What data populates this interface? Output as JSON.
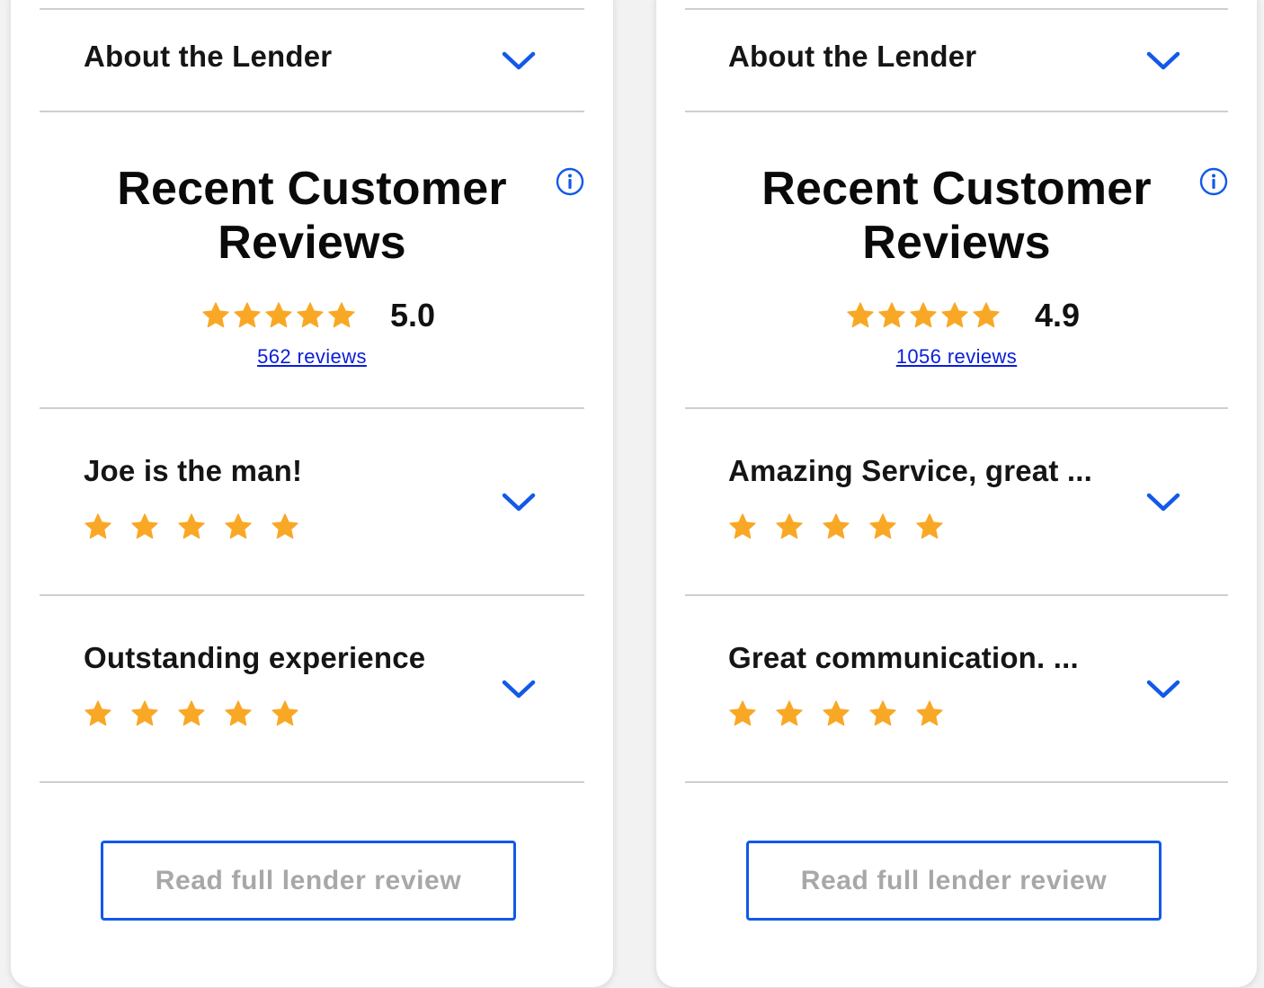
{
  "colors": {
    "accent": "#1259e8",
    "star": "#f9a825",
    "link": "#0a1ed8",
    "button_text": "#a8a8a8",
    "divider": "#cfcfcf"
  },
  "cards": [
    {
      "about_title": "About the Lender",
      "reviews_heading_line1": "Recent Customer",
      "reviews_heading_line2": "Reviews",
      "rating_value": "5.0",
      "rating_stars": 5,
      "review_count": "562 reviews",
      "reviews": [
        {
          "title": "Joe is the man!",
          "stars": 5
        },
        {
          "title": "Outstanding experience",
          "stars": 5
        }
      ],
      "cta_label": "Read full lender review"
    },
    {
      "about_title": "About the Lender",
      "reviews_heading_line1": "Recent Customer",
      "reviews_heading_line2": "Reviews",
      "rating_value": "4.9",
      "rating_stars": 5,
      "review_count": "1056 reviews",
      "reviews": [
        {
          "title": "Amazing Service, great ...",
          "stars": 5
        },
        {
          "title": "Great communication. ...",
          "stars": 5
        }
      ],
      "cta_label": "Read full lender review"
    }
  ],
  "icons": {
    "expand": "chevron-down-icon",
    "info": "info-icon",
    "star": "star-icon"
  }
}
